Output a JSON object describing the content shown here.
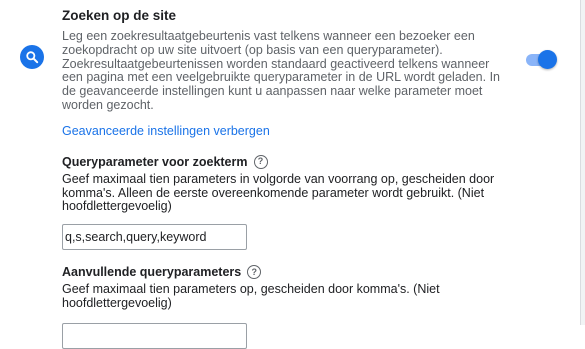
{
  "site_search": {
    "icon": "search-icon",
    "title": "Zoeken op de site",
    "description": "Leg een zoekresultaatgebeurtenis vast telkens wanneer een bezoeker een zoekopdracht op uw site uitvoert (op basis van een queryparameter). Zoekresultaatgebeurtenissen worden standaard geactiveerd telkens wanneer een pagina met een veelgebruikte queryparameter in de URL wordt geladen. In de geavanceerde instellingen kunt u aanpassen naar welke parameter moet worden gezocht.",
    "advanced_link": "Geavanceerde instellingen verbergen",
    "toggle_on": true,
    "colors": {
      "accent": "#1a73e8",
      "toggle_track": "#8ab4f8"
    }
  },
  "query_param": {
    "label": "Queryparameter voor zoekterm",
    "help_icon": "help-circle-icon",
    "help_symbol": "?",
    "description": "Geef maximaal tien parameters in volgorde van voorrang op, gescheiden door komma's. Alleen de eerste overeenkomende parameter wordt gebruikt. (Niet hoofdlettergevoelig)",
    "value": "q,s,search,query,keyword"
  },
  "extra_params": {
    "label": "Aanvullende queryparameters",
    "help_icon": "help-circle-icon",
    "help_symbol": "?",
    "description": "Geef maximaal tien parameters op, gescheiden door komma's. (Niet hoofdlettergevoelig)",
    "value": ""
  }
}
